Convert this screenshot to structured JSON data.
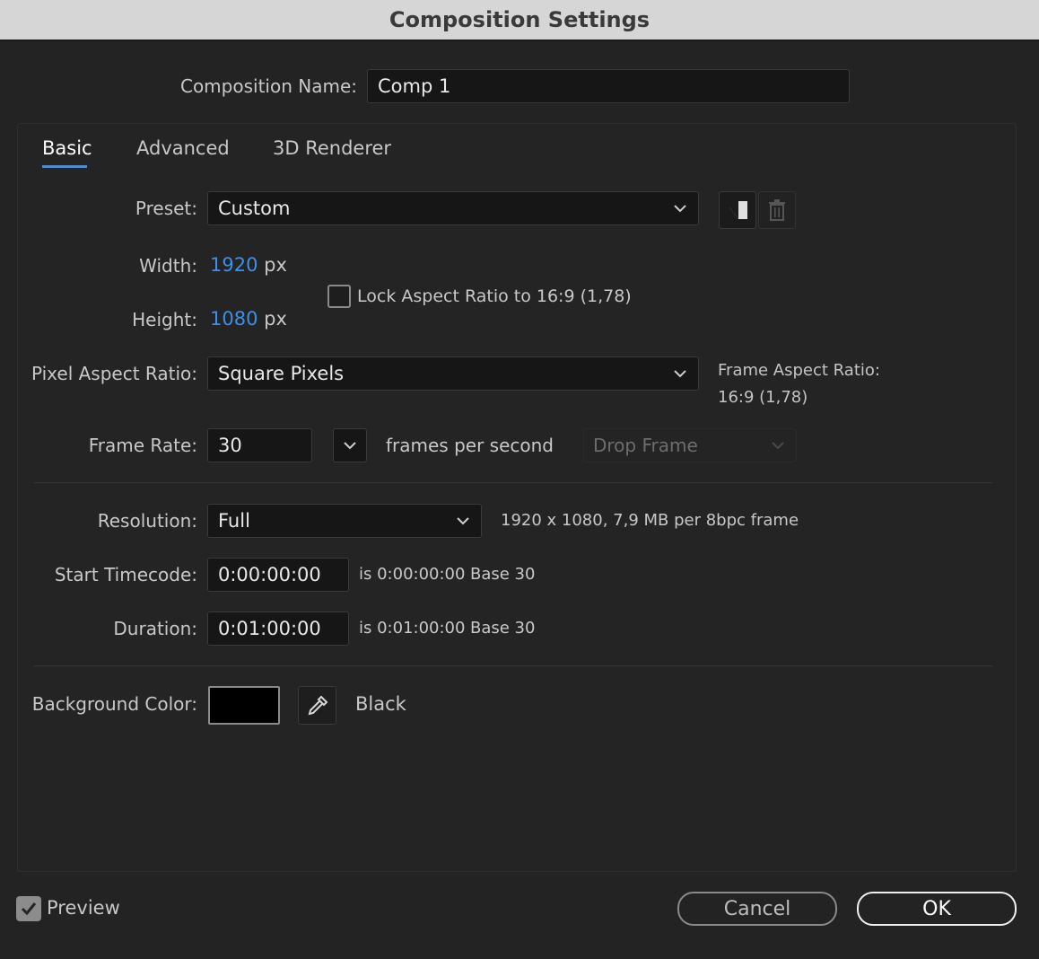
{
  "window": {
    "title": "Composition Settings"
  },
  "comp_name": {
    "label": "Composition Name:",
    "value": "Comp 1"
  },
  "tabs": [
    {
      "label": "Basic",
      "active": true
    },
    {
      "label": "Advanced",
      "active": false
    },
    {
      "label": "3D Renderer",
      "active": false
    }
  ],
  "preset": {
    "label": "Preset:",
    "value": "Custom"
  },
  "width": {
    "label": "Width:",
    "value": "1920",
    "unit": "px"
  },
  "height": {
    "label": "Height:",
    "value": "1080",
    "unit": "px"
  },
  "lock_aspect": {
    "label": "Lock Aspect Ratio to 16:9 (1,78)",
    "checked": false
  },
  "pixel_aspect": {
    "label": "Pixel Aspect Ratio:",
    "value": "Square Pixels"
  },
  "frame_aspect": {
    "label": "Frame Aspect Ratio:",
    "value": "16:9 (1,78)"
  },
  "frame_rate": {
    "label": "Frame Rate:",
    "value": "30",
    "unit": "frames per second",
    "drop_frame": "Drop Frame"
  },
  "resolution": {
    "label": "Resolution:",
    "value": "Full",
    "info": "1920 x 1080, 7,9 MB per 8bpc frame"
  },
  "start_timecode": {
    "label": "Start Timecode:",
    "value": "0:00:00:00",
    "is": "is 0:00:00:00",
    "base": "Base 30"
  },
  "duration": {
    "label": "Duration:",
    "value": "0:01:00:00",
    "is": "is 0:01:00:00",
    "base": "Base 30"
  },
  "background": {
    "label": "Background Color:",
    "color": "#000000",
    "name": "Black"
  },
  "footer": {
    "preview_label": "Preview",
    "preview_checked": true,
    "cancel_label": "Cancel",
    "ok_label": "OK"
  },
  "colors": {
    "accent": "#3d8fe8",
    "background": "#232323",
    "titlebar": "#d6d6d6"
  }
}
